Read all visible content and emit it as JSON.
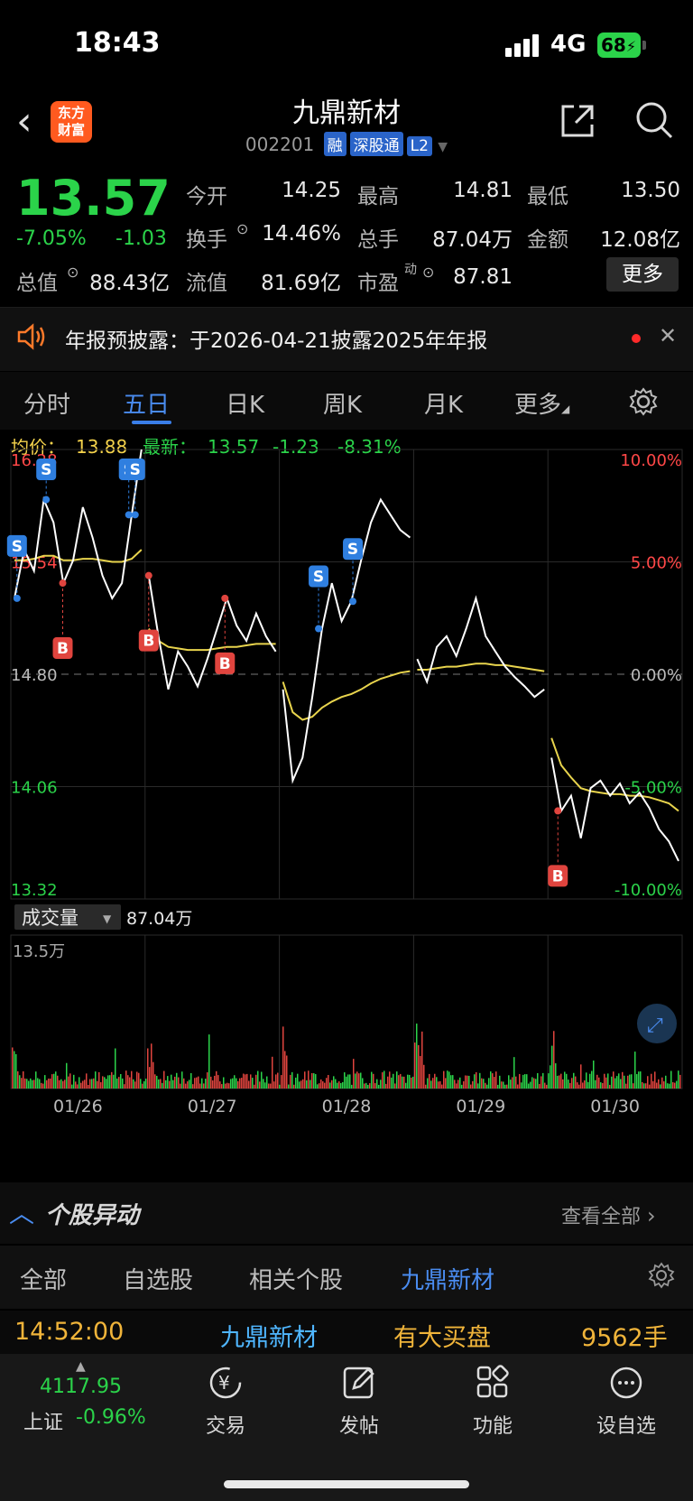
{
  "status_bar": {
    "time": "18:43",
    "network": "4G",
    "battery": "68"
  },
  "header": {
    "stock_name": "九鼎新材",
    "stock_code": "002201",
    "tags": [
      "融",
      "深股通",
      "L2"
    ],
    "logo_line1": "东方",
    "logo_line2": "财富"
  },
  "quote": {
    "price": "13.57",
    "change_pct": "-7.05%",
    "change": "-1.03",
    "fields": {
      "open_label": "今开",
      "open": "14.25",
      "high_label": "最高",
      "high": "14.81",
      "low_label": "最低",
      "low": "13.50",
      "turnover_label": "换手",
      "turnover": "14.46%",
      "volume_label": "总手",
      "volume": "87.04万",
      "amount_label": "金额",
      "amount": "12.08亿",
      "mcap_label": "总值",
      "mcap": "88.43亿",
      "float_label": "流值",
      "float": "81.69亿",
      "pe_label": "市盈",
      "pe_sup": "动",
      "pe": "87.81"
    },
    "more_label": "更多"
  },
  "notice": {
    "text": "年报预披露：于2026-04-21披露2025年年报"
  },
  "tabs": [
    "分时",
    "五日",
    "日K",
    "周K",
    "月K",
    "更多"
  ],
  "active_tab": "五日",
  "chart_header": {
    "avg_label": "均价：",
    "avg": "13.88",
    "latest_label": "最新：",
    "latest": "13.57",
    "latest_chg": "-1.23",
    "latest_pct": "-8.31%"
  },
  "chart_data": {
    "type": "line",
    "y_labels_left": [
      "16.28",
      "15.54",
      "14.80",
      "14.06",
      "13.32"
    ],
    "y_labels_right": [
      "10.00%",
      "5.00%",
      "0.00%",
      "-5.00%",
      "-10.00%"
    ],
    "ylim": [
      13.32,
      16.28
    ],
    "prev_close": 14.8,
    "x_labels": [
      "01/26",
      "01/27",
      "01/28",
      "01/29",
      "01/30"
    ],
    "price_series": [
      [
        15.3,
        15.62,
        15.48,
        15.95,
        15.8,
        15.4,
        15.55,
        15.9,
        15.7,
        15.45,
        15.3,
        15.4,
        15.85,
        16.28
      ],
      [
        15.45,
        15.05,
        14.7,
        14.95,
        14.85,
        14.72,
        14.9,
        15.1,
        15.3,
        15.12,
        15.02,
        15.2,
        15.05,
        14.95
      ],
      [
        14.7,
        14.1,
        14.25,
        14.65,
        15.1,
        15.4,
        15.15,
        15.28,
        15.55,
        15.8,
        15.95,
        15.85,
        15.75,
        15.7
      ],
      [
        14.9,
        14.75,
        14.98,
        15.05,
        14.92,
        15.1,
        15.3,
        15.05,
        14.95,
        14.85,
        14.78,
        14.72,
        14.65,
        14.7
      ],
      [
        14.25,
        13.9,
        14.0,
        13.72,
        14.05,
        14.1,
        14.0,
        14.08,
        13.95,
        14.02,
        13.92,
        13.78,
        13.7,
        13.57
      ]
    ],
    "avg_series": [
      [
        15.55,
        15.55,
        15.56,
        15.58,
        15.58,
        15.55,
        15.55,
        15.56,
        15.56,
        15.55,
        15.54,
        15.54,
        15.56,
        15.62
      ],
      [
        15.1,
        15.02,
        14.98,
        14.97,
        14.96,
        14.96,
        14.96,
        14.97,
        14.98,
        14.98,
        14.99,
        15.0,
        15.0,
        15.0
      ],
      [
        14.75,
        14.55,
        14.5,
        14.52,
        14.58,
        14.62,
        14.65,
        14.67,
        14.7,
        14.74,
        14.77,
        14.79,
        14.81,
        14.82
      ],
      [
        14.83,
        14.83,
        14.84,
        14.85,
        14.85,
        14.86,
        14.87,
        14.87,
        14.86,
        14.86,
        14.85,
        14.84,
        14.83,
        14.82
      ],
      [
        14.38,
        14.2,
        14.12,
        14.05,
        14.03,
        14.02,
        14.01,
        14.01,
        14.0,
        14.0,
        13.99,
        13.97,
        13.95,
        13.9
      ]
    ],
    "trade_markers": [
      {
        "label": "S",
        "day": 0,
        "t": 0.02
      },
      {
        "label": "S",
        "day": 0,
        "t": 0.25
      },
      {
        "label": "S",
        "day": 0,
        "t": 0.9
      },
      {
        "label": "S",
        "day": 0,
        "t": 0.95
      },
      {
        "label": "B",
        "day": 0,
        "t": 0.38
      },
      {
        "label": "B",
        "day": 1,
        "t": 0.0
      },
      {
        "label": "B",
        "day": 1,
        "t": 0.6
      },
      {
        "label": "S",
        "day": 2,
        "t": 0.28
      },
      {
        "label": "S",
        "day": 2,
        "t": 0.55
      },
      {
        "label": "B",
        "day": 4,
        "t": 0.05
      }
    ],
    "volume_label": "成交量",
    "volume_total": "87.04万",
    "volume_max_label": "13.5万"
  },
  "movement": {
    "title": "个股异动",
    "see_all": "查看全部",
    "filters": [
      "全部",
      "自选股",
      "相关个股",
      "九鼎新材"
    ],
    "active_filter": "九鼎新材",
    "row": {
      "time": "14:52:00",
      "name": "九鼎新材",
      "event": "有大买盘",
      "qty": "9562手"
    }
  },
  "bottom_nav": {
    "index_value": "4117.95",
    "index_name": "上证",
    "index_pct": "-0.96%",
    "items": [
      "交易",
      "发帖",
      "功能",
      "设自选"
    ]
  }
}
